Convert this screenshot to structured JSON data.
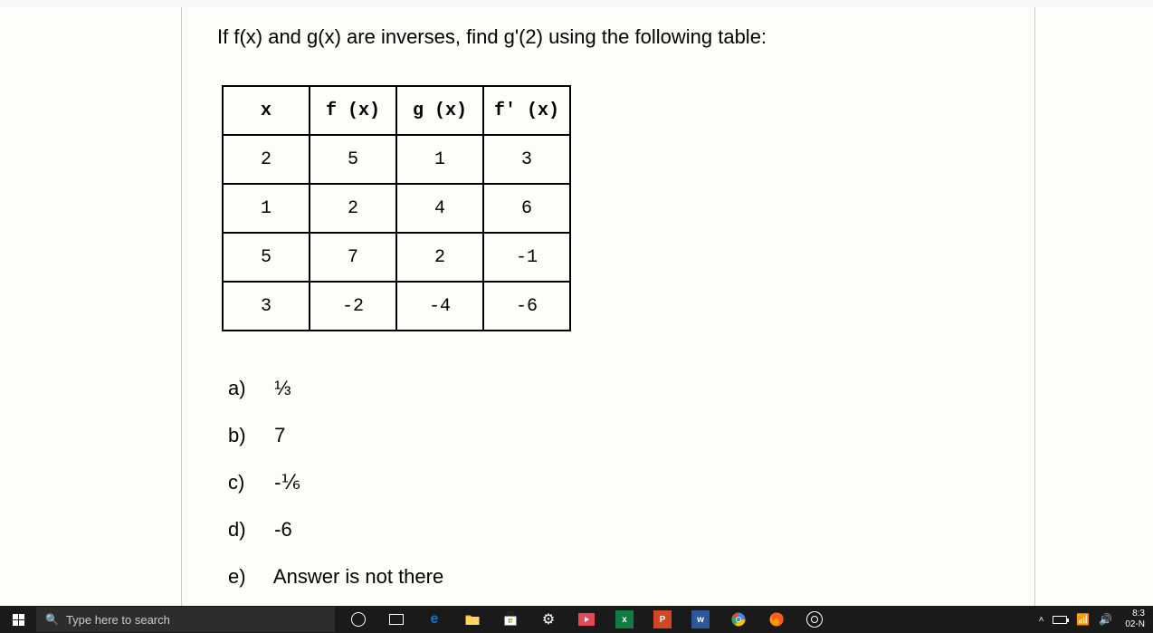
{
  "question": "If f(x) and g(x) are inverses, find g'(2) using the following table:",
  "table": {
    "headers": [
      "x",
      "f (x)",
      "g (x)",
      "f' (x)"
    ],
    "rows": [
      [
        "2",
        "5",
        "1",
        "3"
      ],
      [
        "1",
        "2",
        "4",
        "6"
      ],
      [
        "5",
        "7",
        "2",
        "-1"
      ],
      [
        "3",
        "-2",
        "-4",
        "-6"
      ]
    ]
  },
  "options": [
    {
      "label": "a)",
      "text": "⅓"
    },
    {
      "label": "b)",
      "text": "7"
    },
    {
      "label": "c)",
      "text": "-⅙"
    },
    {
      "label": "d)",
      "text": "-6"
    },
    {
      "label": "e)",
      "text": "Answer is not there"
    }
  ],
  "taskbar": {
    "search_placeholder": "Type here to search",
    "time": "8:3",
    "date": "02-N"
  }
}
